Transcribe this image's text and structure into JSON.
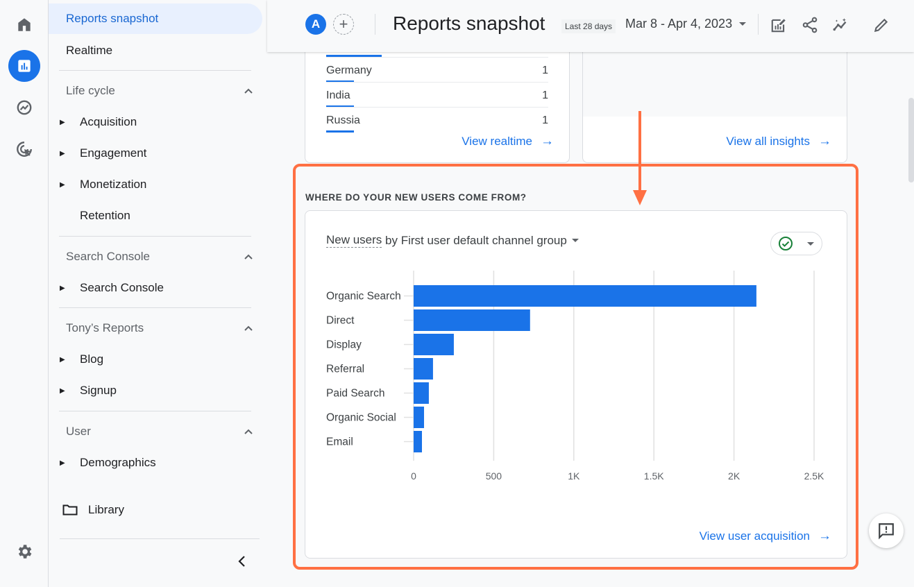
{
  "rail": {
    "items": [
      {
        "name": "home",
        "icon": "home-icon"
      },
      {
        "name": "reports",
        "icon": "bar-chart-icon",
        "active": true
      },
      {
        "name": "explore",
        "icon": "explore-icon"
      },
      {
        "name": "advertising",
        "icon": "advertising-icon"
      }
    ],
    "settings_icon": "gear-icon"
  },
  "nav": {
    "top_items": [
      {
        "label": "Reports snapshot",
        "active": true
      },
      {
        "label": "Realtime"
      }
    ],
    "sections": [
      {
        "heading": "Life cycle",
        "items": [
          {
            "label": "Acquisition",
            "expandable": true
          },
          {
            "label": "Engagement",
            "expandable": true
          },
          {
            "label": "Monetization",
            "expandable": true
          },
          {
            "label": "Retention",
            "expandable": false
          }
        ]
      },
      {
        "heading": "Search Console",
        "items": [
          {
            "label": "Search Console",
            "expandable": true
          }
        ]
      },
      {
        "heading": "Tony’s Reports",
        "items": [
          {
            "label": "Blog",
            "expandable": true
          },
          {
            "label": "Signup",
            "expandable": true
          }
        ]
      },
      {
        "heading": "User",
        "items": [
          {
            "label": "Demographics",
            "expandable": true
          }
        ]
      }
    ],
    "library_label": "Library"
  },
  "header": {
    "avatar_letter": "A",
    "title": "Reports snapshot",
    "range_chip": "Last 28 days",
    "date_range": "Mar 8 - Apr 4, 2023",
    "actions": [
      "customize-report-icon",
      "share-icon",
      "insights-icon",
      "edit-icon"
    ]
  },
  "realtime_card": {
    "rows": [
      {
        "name": "Germany",
        "value": "1"
      },
      {
        "name": "India",
        "value": "1"
      },
      {
        "name": "Russia",
        "value": "1"
      }
    ],
    "link": "View realtime"
  },
  "insights_card": {
    "link": "View all insights"
  },
  "acquisition": {
    "section_title": "WHERE DO YOUR NEW USERS COME FROM?",
    "chart_title_metric": "New users",
    "chart_title_rest": "by First user default channel group",
    "link": "View user acquisition"
  },
  "colors": {
    "accent": "#1a73e8",
    "highlight": "#ff7043",
    "status_ok": "#188038"
  },
  "chart_data": {
    "type": "bar",
    "orientation": "horizontal",
    "title": "New users by First user default channel group",
    "xlabel": "",
    "ylabel": "",
    "categories": [
      "Organic Search",
      "Direct",
      "Display",
      "Referral",
      "Paid Search",
      "Organic Social",
      "Email"
    ],
    "values": [
      2140,
      727,
      251,
      121,
      95,
      65,
      52
    ],
    "xlim": [
      0,
      2500
    ],
    "xticks": [
      0,
      500,
      1000,
      1500,
      2000,
      2500
    ],
    "xtick_labels": [
      "0",
      "500",
      "1K",
      "1.5K",
      "2K",
      "2.5K"
    ],
    "grid": true,
    "legend": "none"
  }
}
